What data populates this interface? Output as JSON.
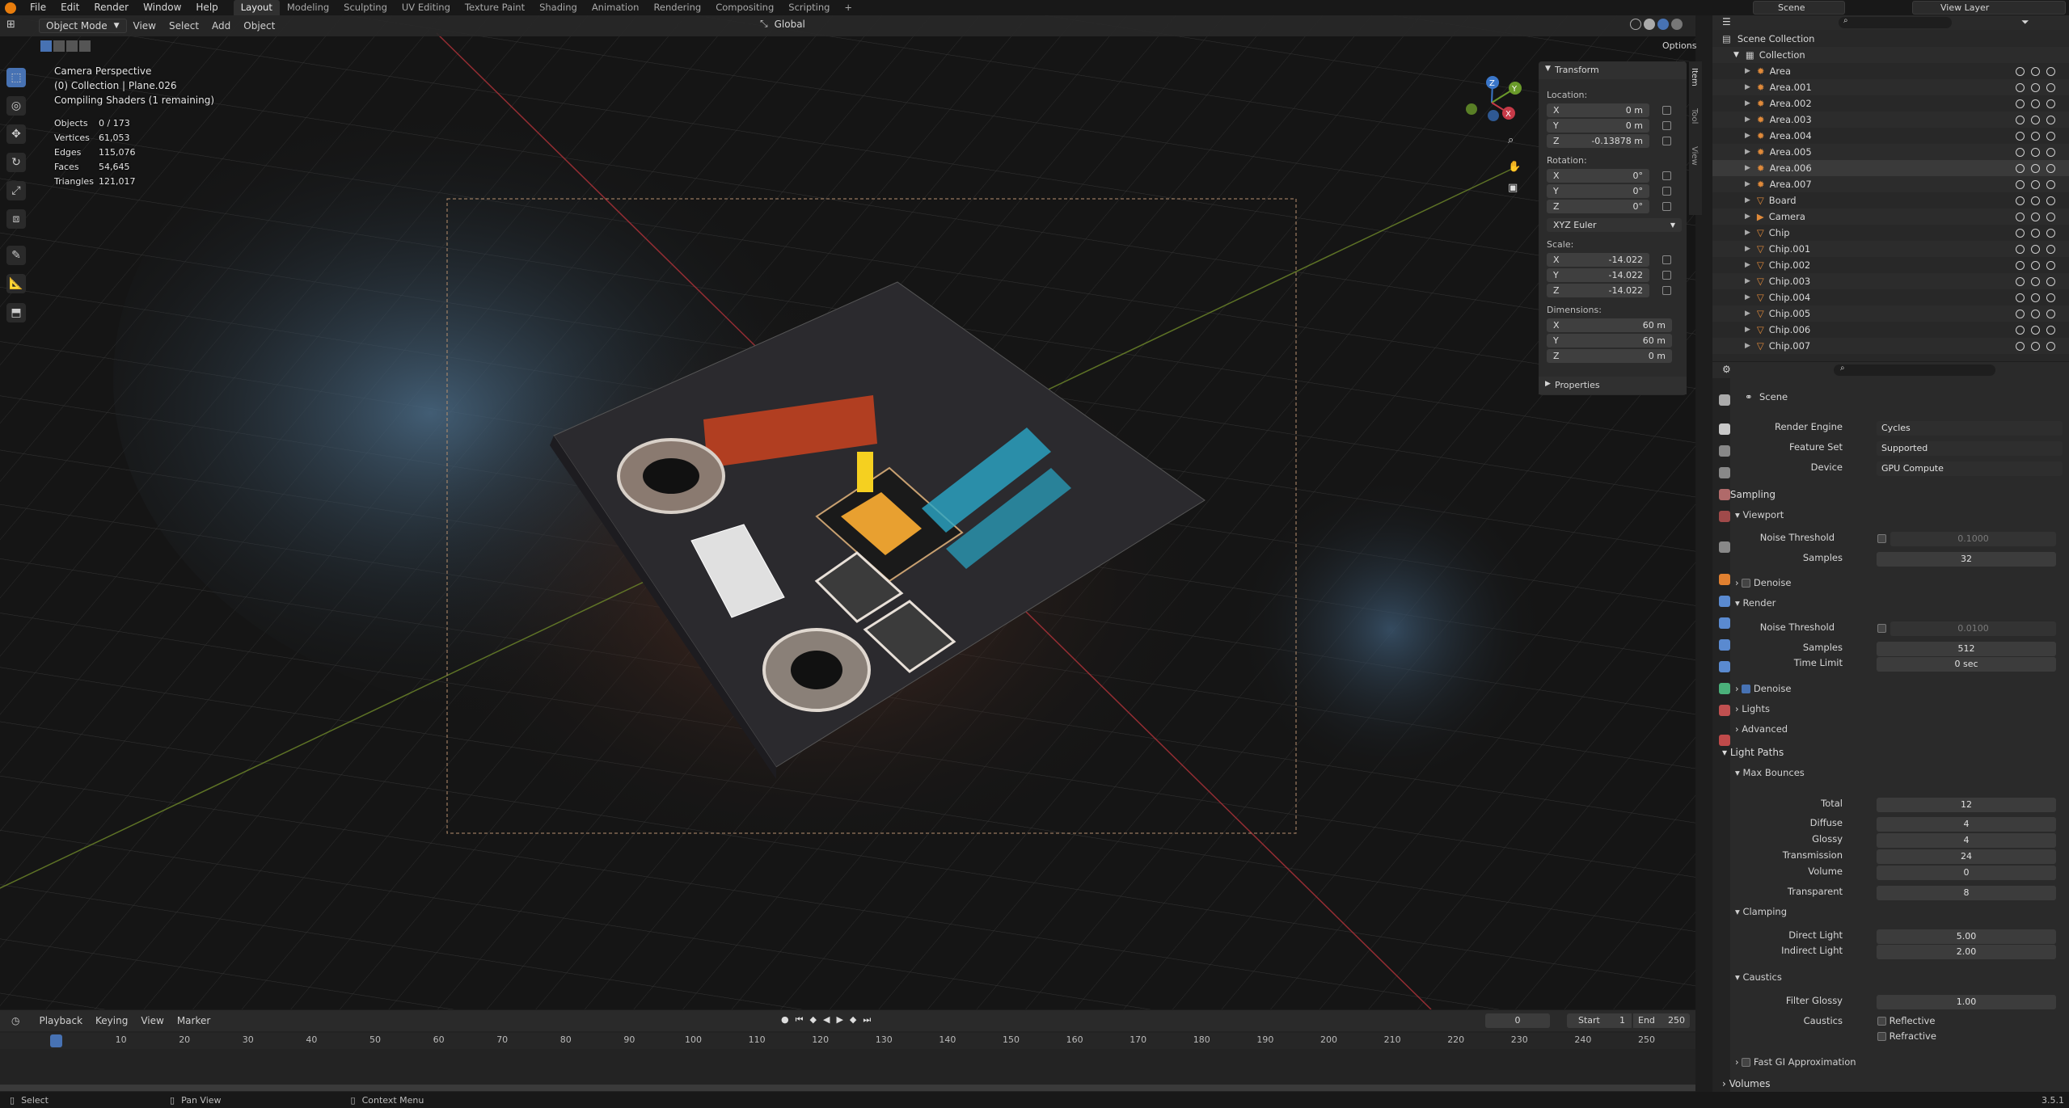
{
  "topbar": {
    "menus": [
      "File",
      "Edit",
      "Render",
      "Window",
      "Help"
    ],
    "workspaces": [
      "Layout",
      "Modeling",
      "Sculpting",
      "UV Editing",
      "Texture Paint",
      "Shading",
      "Animation",
      "Rendering",
      "Compositing",
      "Scripting",
      "+"
    ],
    "active_workspace": "Layout",
    "scene_name": "Scene",
    "view_layer": "View Layer"
  },
  "viewport_header": {
    "mode": "Object Mode",
    "menus": [
      "View",
      "Select",
      "Add",
      "Object"
    ],
    "transform_orientation": "Global",
    "options": "Options"
  },
  "overlay": {
    "lines": [
      "Camera Perspective",
      "(0) Collection | Plane.026",
      "Compiling Shaders (1 remaining)"
    ],
    "stats": [
      {
        "label": "Objects",
        "value": "0 / 173"
      },
      {
        "label": "Vertices",
        "value": "61,053"
      },
      {
        "label": "Edges",
        "value": "115,076"
      },
      {
        "label": "Faces",
        "value": "54,645"
      },
      {
        "label": "Triangles",
        "value": "121,017"
      }
    ]
  },
  "npanel": {
    "tabs": [
      "Item",
      "Tool",
      "View"
    ],
    "title": "Transform",
    "location_label": "Location:",
    "location": [
      {
        "axis": "X",
        "value": "0 m"
      },
      {
        "axis": "Y",
        "value": "0 m"
      },
      {
        "axis": "Z",
        "value": "-0.13878 m"
      }
    ],
    "rotation_label": "Rotation:",
    "rotation": [
      {
        "axis": "X",
        "value": "0°"
      },
      {
        "axis": "Y",
        "value": "0°"
      },
      {
        "axis": "Z",
        "value": "0°"
      }
    ],
    "rotation_mode": "XYZ Euler",
    "scale_label": "Scale:",
    "scale": [
      {
        "axis": "X",
        "value": "-14.022"
      },
      {
        "axis": "Y",
        "value": "-14.022"
      },
      {
        "axis": "Z",
        "value": "-14.022"
      }
    ],
    "dimensions_label": "Dimensions:",
    "dimensions": [
      {
        "axis": "X",
        "value": "60 m"
      },
      {
        "axis": "Y",
        "value": "60 m"
      },
      {
        "axis": "Z",
        "value": "0 m"
      }
    ],
    "properties": "Properties"
  },
  "timeline": {
    "menus": [
      "Playback",
      "Keying",
      "View",
      "Marker"
    ],
    "current_frame": "0",
    "start_label": "Start",
    "start": "1",
    "end_label": "End",
    "end": "250",
    "ticks": [
      "0",
      "10",
      "20",
      "30",
      "40",
      "50",
      "60",
      "70",
      "80",
      "90",
      "100",
      "110",
      "120",
      "130",
      "140",
      "150",
      "160",
      "170",
      "180",
      "190",
      "200",
      "210",
      "220",
      "230",
      "240",
      "250"
    ]
  },
  "statusbar": {
    "select": "Select",
    "pan": "Pan View",
    "context": "Context Menu",
    "version": "3.5.1"
  },
  "outliner": {
    "root": "Scene Collection",
    "collection": "Collection",
    "items": [
      "Area",
      "Area.001",
      "Area.002",
      "Area.003",
      "Area.004",
      "Area.005",
      "Area.006",
      "Area.007",
      "Board",
      "Camera",
      "Chip",
      "Chip.001",
      "Chip.002",
      "Chip.003",
      "Chip.004",
      "Chip.005",
      "Chip.006",
      "Chip.007"
    ],
    "selected": "Area.006"
  },
  "properties": {
    "header": "Scene",
    "render_engine_label": "Render Engine",
    "render_engine": "Cycles",
    "feature_set_label": "Feature Set",
    "feature_set": "Supported",
    "device_label": "Device",
    "device": "GPU Compute",
    "sampling": "Sampling",
    "viewport": "Viewport",
    "noise_threshold_label": "Noise Threshold",
    "viewport_noise": "0.1000",
    "samples_label": "Samples",
    "viewport_samples": "32",
    "denoise": "Denoise",
    "render": "Render",
    "render_noise": "0.0100",
    "render_samples": "512",
    "time_limit_label": "Time Limit",
    "time_limit": "0 sec",
    "lights": "Lights",
    "advanced": "Advanced",
    "light_paths": "Light Paths",
    "max_bounces": "Max Bounces",
    "bounces": [
      {
        "label": "Total",
        "value": "12"
      },
      {
        "label": "Diffuse",
        "value": "4"
      },
      {
        "label": "Glossy",
        "value": "4"
      },
      {
        "label": "Transmission",
        "value": "24"
      },
      {
        "label": "Volume",
        "value": "0"
      },
      {
        "label": "Transparent",
        "value": "8"
      }
    ],
    "clamping": "Clamping",
    "direct_light_label": "Direct Light",
    "direct_light": "5.00",
    "indirect_light_label": "Indirect Light",
    "indirect_light": "2.00",
    "caustics": "Caustics",
    "filter_glossy_label": "Filter Glossy",
    "filter_glossy": "1.00",
    "caustics_label": "Caustics",
    "reflective": "Reflective",
    "refractive": "Refractive",
    "fast_gi": "Fast GI Approximation",
    "volumes": "Volumes"
  }
}
